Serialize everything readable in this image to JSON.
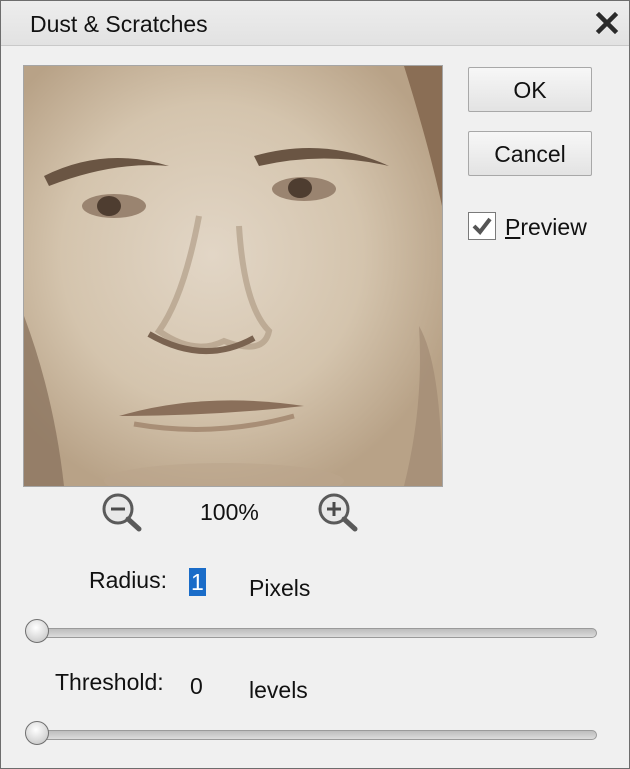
{
  "dialog": {
    "title": "Dust & Scratches",
    "close_icon": "close-icon"
  },
  "buttons": {
    "ok_label": "OK",
    "cancel_label": "Cancel"
  },
  "preview_option": {
    "label_underlined": "P",
    "label_rest": "review",
    "checked": true
  },
  "zoom": {
    "level": "100%",
    "zoom_out_icon": "zoom-out-icon",
    "zoom_in_icon": "zoom-in-icon"
  },
  "radius": {
    "label": "Radius:",
    "value": "1",
    "unit": "Pixels",
    "slider_fraction": 0.0
  },
  "threshold": {
    "label": "Threshold:",
    "value": "0",
    "unit": "levels",
    "slider_fraction": 0.0
  },
  "colors": {
    "selection": "#1a6cc8",
    "dialog_bg": "#f0f0f0",
    "photo_sepia": "#c8b7a1"
  }
}
